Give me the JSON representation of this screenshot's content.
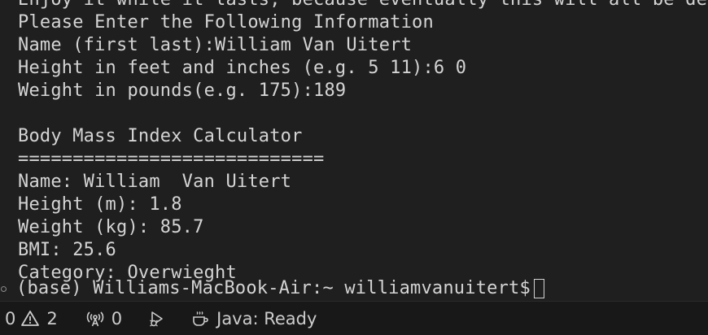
{
  "terminal": {
    "lines": [
      "Enjoy it while it lasts, because eventually this will all be deprecated",
      "Please Enter the Following Information",
      "Name (first last):William Van Uitert",
      "Height in feet and inches (e.g. 5 11):6 0",
      "Weight in pounds(e.g. 175):189",
      "",
      "Body Mass Index Calculator",
      "============================",
      "Name: William  Van Uitert",
      "Height (m): 1.8",
      "Weight (kg): 85.7",
      "BMI: 25.6",
      "Category: Overwieght"
    ],
    "prompt": "(base) Williams-MacBook-Air:~ williamvanuitert$"
  },
  "statusbar": {
    "errors_count": "0",
    "warnings_count": "2",
    "ports_count": "0",
    "java_status": "Java: Ready",
    "icons": {
      "warnings": "warning-icon",
      "ports": "broadcast-icon",
      "debug": "run-debug-icon",
      "java": "coffee-cup-icon"
    }
  }
}
